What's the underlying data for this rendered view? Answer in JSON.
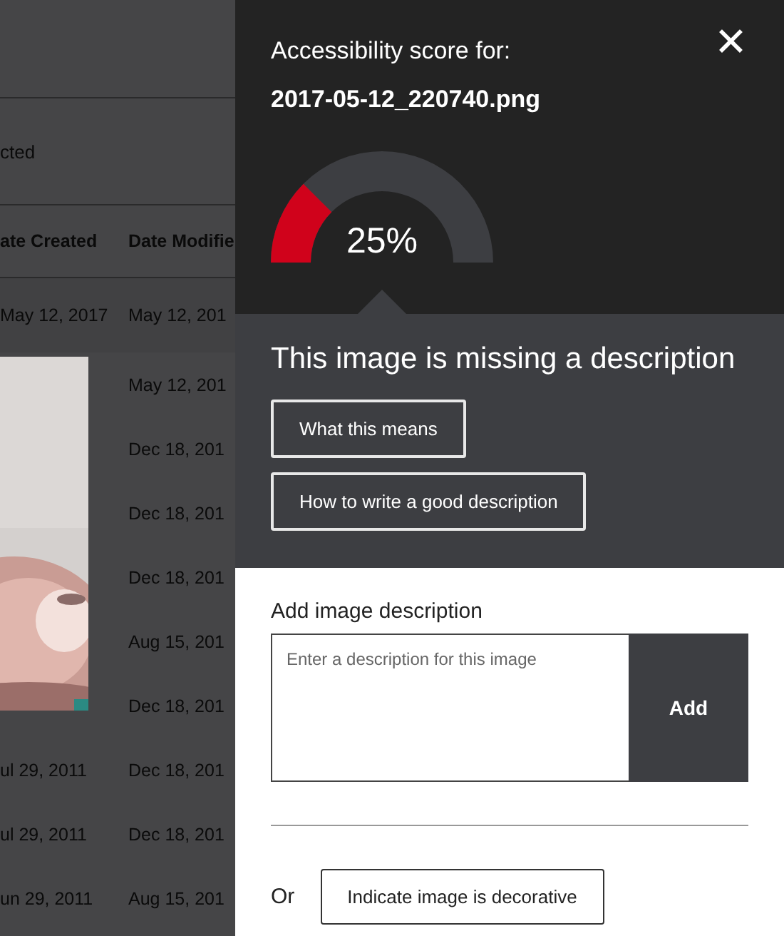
{
  "background": {
    "selection_text": "cted",
    "table": {
      "columns": [
        "ate Created",
        "Date Modifie"
      ],
      "rows": [
        {
          "created": "May 12, 2017",
          "modified": "May 12, 201"
        },
        {
          "modified": "May 12, 201"
        },
        {
          "modified": "Dec 18, 201"
        },
        {
          "modified": "Dec 18, 201"
        },
        {
          "modified": "Dec 18, 201"
        },
        {
          "modified": "Aug 15, 201"
        },
        {
          "modified": "Dec 18, 201"
        },
        {
          "created": "ul 29, 2011",
          "modified": "Dec 18, 201"
        },
        {
          "created": "ul 29, 2011",
          "modified": "Dec 18, 201"
        },
        {
          "created": "un 29, 2011",
          "modified": "Aug 15, 201"
        }
      ]
    }
  },
  "panel": {
    "heading": "Accessibility score for:",
    "filename": "2017-05-12_220740.png",
    "close": "✕",
    "score": {
      "reading": "25%"
    },
    "issue": {
      "title": "This image is missing a description",
      "buttons": [
        "What this means",
        "How to write a good description"
      ]
    },
    "description": {
      "label": "Add image description",
      "placeholder": "Enter a description for this image",
      "add_button": "Add"
    },
    "alternative": {
      "or": "Or",
      "button": "Indicate image is decorative"
    }
  }
}
